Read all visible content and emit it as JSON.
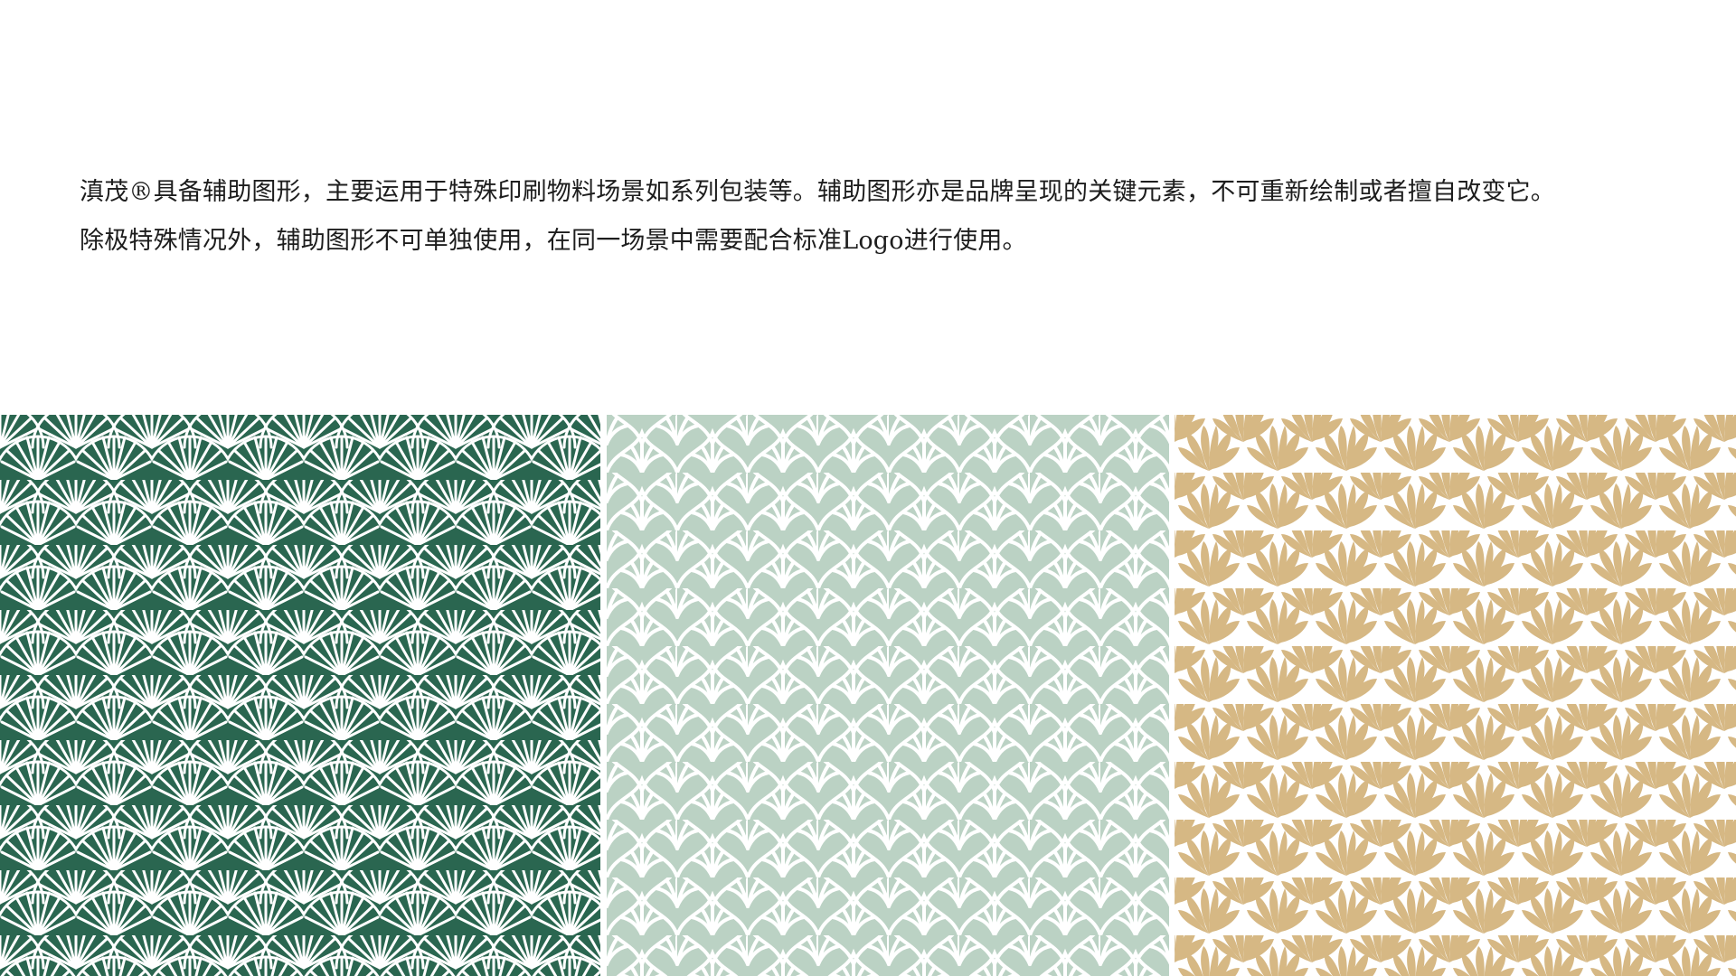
{
  "intro": {
    "line1": "滇茂®具备辅助图形，主要运用于特殊印刷物料场景如系列包装等。辅助图形亦是品牌呈现的关键元素，不可重新绘制或者擅自改变它。",
    "line2": "除极特殊情况外，辅助图形不可单独使用，在同一场景中需要配合标准Logo进行使用。"
  },
  "patterns": [
    {
      "name": "fan",
      "color": "#2a6650",
      "line_color": "#ffffff"
    },
    {
      "name": "leaf-lattice",
      "color": "#bbd2c4",
      "line_color": "#ffffff"
    },
    {
      "name": "shell",
      "color": "#d6b884",
      "background": "#ffffff"
    }
  ]
}
